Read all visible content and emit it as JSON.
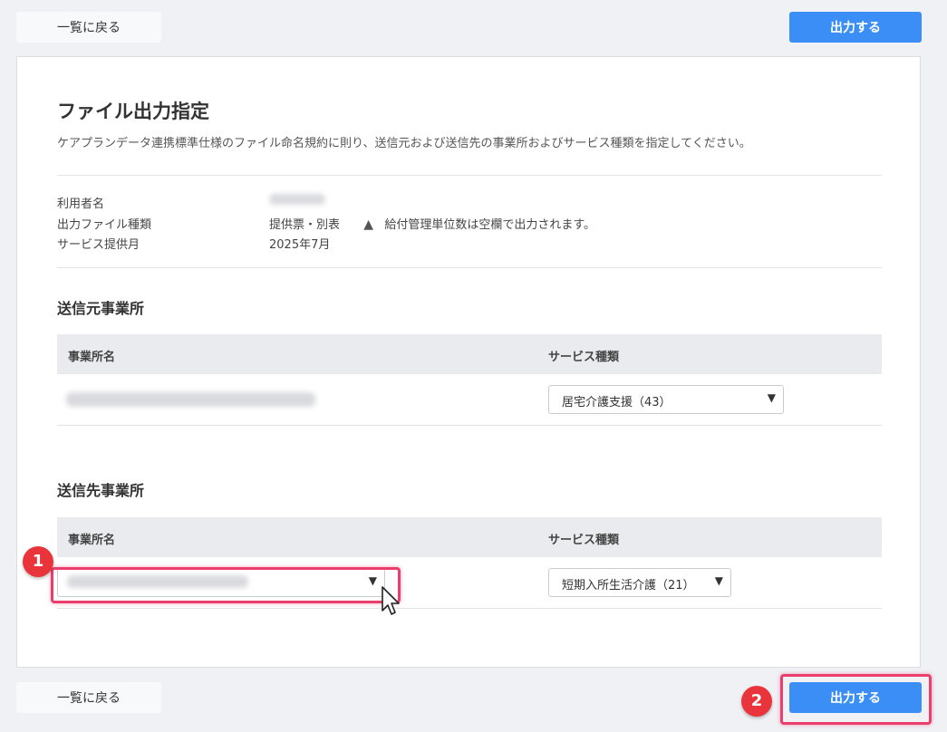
{
  "toolbar": {
    "back_label": "一覧に戻る",
    "output_label": "出力する"
  },
  "page": {
    "title": "ファイル出力指定",
    "description": "ケアプランデータ連携標準仕様のファイル命名規約に則り、送信元および送信先の事業所およびサービス種類を指定してください。"
  },
  "info": {
    "user_label": "利用者名",
    "filetype_label": "出力ファイル種類",
    "filetype_value": "提供票・別表",
    "warning_text": "給付管理単位数は空欄で出力されます。",
    "month_label": "サービス提供月",
    "month_value": "2025年7月"
  },
  "sender": {
    "section_title": "送信元事業所",
    "col_office": "事業所名",
    "col_service": "サービス種類",
    "service_value": "居宅介護支援（43）"
  },
  "receiver": {
    "section_title": "送信先事業所",
    "col_office": "事業所名",
    "col_service": "サービス種類",
    "service_value": "短期入所生活介護（21）"
  },
  "annotations": {
    "step1": "1",
    "step2": "2"
  },
  "colors": {
    "primary": "#3b8ef5",
    "highlight": "#ea3f6d",
    "badge": "#e8343a"
  }
}
